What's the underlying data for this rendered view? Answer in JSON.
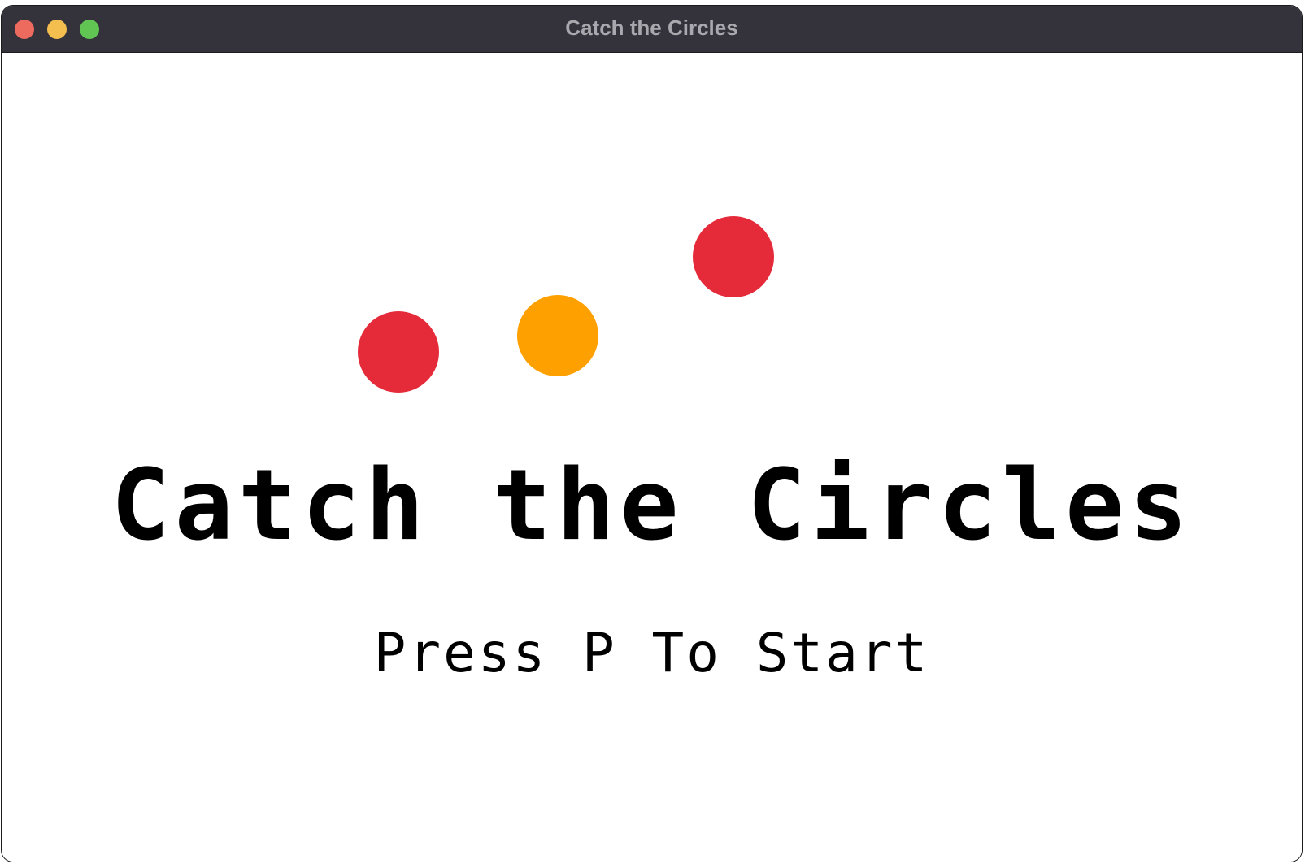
{
  "window": {
    "title": "Catch the Circles",
    "controls": {
      "close_color": "#ed6a5e",
      "minimize_color": "#f5bf4f",
      "zoom_color": "#61c554"
    }
  },
  "game": {
    "title": "Catch the Circles",
    "prompt": "Press P To Start",
    "circles": [
      {
        "name": "red-circle-left",
        "color": "#e52a3a"
      },
      {
        "name": "orange-circle-middle",
        "color": "#ffa001"
      },
      {
        "name": "red-circle-right",
        "color": "#e52a3a"
      }
    ]
  }
}
